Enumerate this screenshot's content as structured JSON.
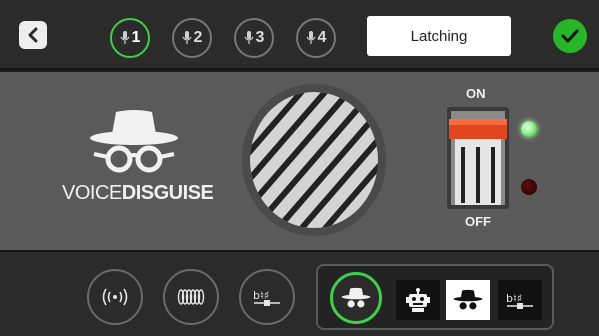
{
  "topbar": {
    "mic_buttons": [
      {
        "label": "1",
        "active": true
      },
      {
        "label": "2",
        "active": false
      },
      {
        "label": "3",
        "active": false
      },
      {
        "label": "4",
        "active": false
      }
    ],
    "mode_label": "Latching"
  },
  "main": {
    "logo_text_thin": "VOICE",
    "logo_text_bold": "DISGUISE",
    "switch_on_label": "ON",
    "switch_off_label": "OFF"
  },
  "colors": {
    "accent_green": "#3cd146",
    "confirm_green": "#27b627",
    "switch_handle_orange": "#e2461f"
  },
  "icons": {
    "back": "chevron-left-icon",
    "confirm": "checkmark-icon",
    "mic": "microphone-icon",
    "effects": [
      "radio-waves-icon",
      "coil-icon",
      "pitch-shift-icon"
    ],
    "voices": [
      "disguise-face-icon",
      "robot-icon",
      "disguise-face-icon",
      "pitch-shift-icon"
    ]
  }
}
